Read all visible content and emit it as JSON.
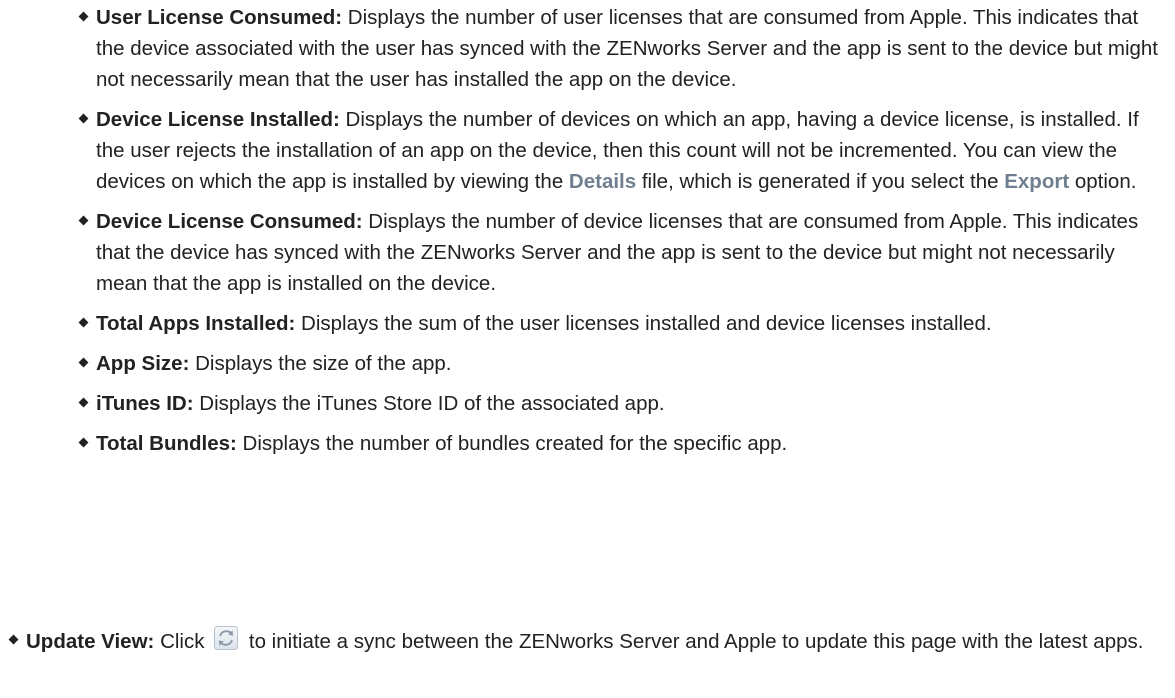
{
  "sub_items": [
    {
      "term": "User License Consumed:",
      "text": "Displays the number of user licenses that are consumed from Apple. This indicates that the device associated with the user has synced with the ZENworks Server and the app is sent to the device but might not necessarily mean that the user has installed the app on the device."
    },
    {
      "term": "Device License Installed:",
      "text_1": "Displays the number of devices on which an app, having a device license, is installed. If the user rejects the installation of an app on the device, then this count will not be incremented. You can view the devices on which the app is installed by viewing the",
      "ref_1": "Details",
      "text_2": "file, which is generated if you select the",
      "ref_2": "Export",
      "text_3": "option."
    },
    {
      "term": "Device License Consumed:",
      "text": "Displays the number of device licenses that are consumed from Apple. This indicates that the device has synced with the ZENworks Server and the app is sent to the device but might not necessarily mean that the app is installed on the device."
    },
    {
      "term": "Total Apps Installed:",
      "text": "Displays the sum of the user licenses installed and device licenses installed."
    },
    {
      "term": "App Size:",
      "text": "Displays the size of the app."
    },
    {
      "term": "iTunes ID:",
      "text": "Displays the iTunes Store ID of the associated app."
    },
    {
      "term": "Total Bundles:",
      "text": "Displays the number of bundles created for the specific app."
    }
  ],
  "update_view": {
    "term": "Update View:",
    "text_before_icon": "Click",
    "icon": "refresh-icon",
    "text_after_icon": "to initiate a sync between the ZENworks Server and Apple to update this page with the latest apps."
  }
}
